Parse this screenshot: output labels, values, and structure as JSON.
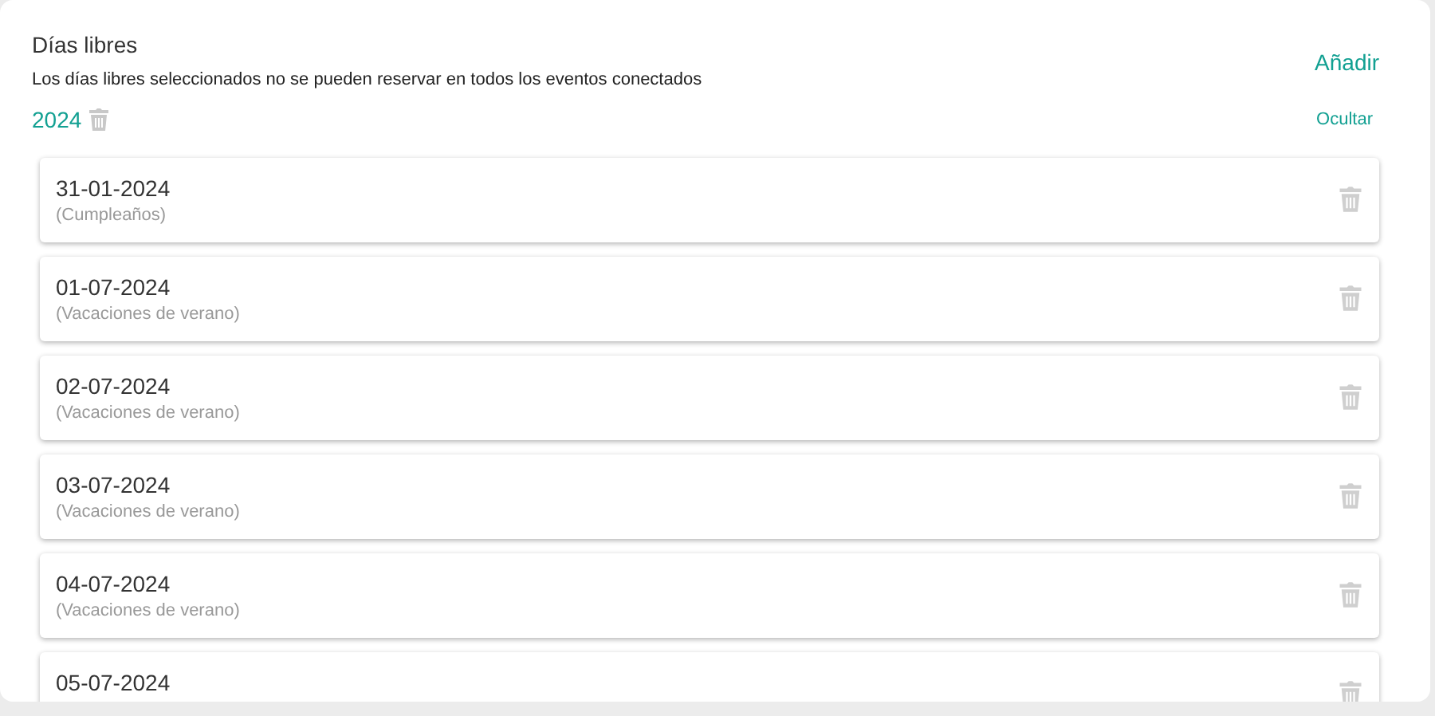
{
  "header": {
    "title": "Días libres",
    "subtitle": "Los días libres seleccionados no se pueden reservar en todos los eventos conectados",
    "add_button": "Añadir"
  },
  "year_group": {
    "year": "2024",
    "toggle": "Ocultar"
  },
  "days": [
    {
      "date": "31-01-2024",
      "reason": "(Cumpleaños)"
    },
    {
      "date": "01-07-2024",
      "reason": "(Vacaciones de verano)"
    },
    {
      "date": "02-07-2024",
      "reason": "(Vacaciones de verano)"
    },
    {
      "date": "03-07-2024",
      "reason": "(Vacaciones de verano)"
    },
    {
      "date": "04-07-2024",
      "reason": "(Vacaciones de verano)"
    },
    {
      "date": "05-07-2024"
    }
  ]
}
